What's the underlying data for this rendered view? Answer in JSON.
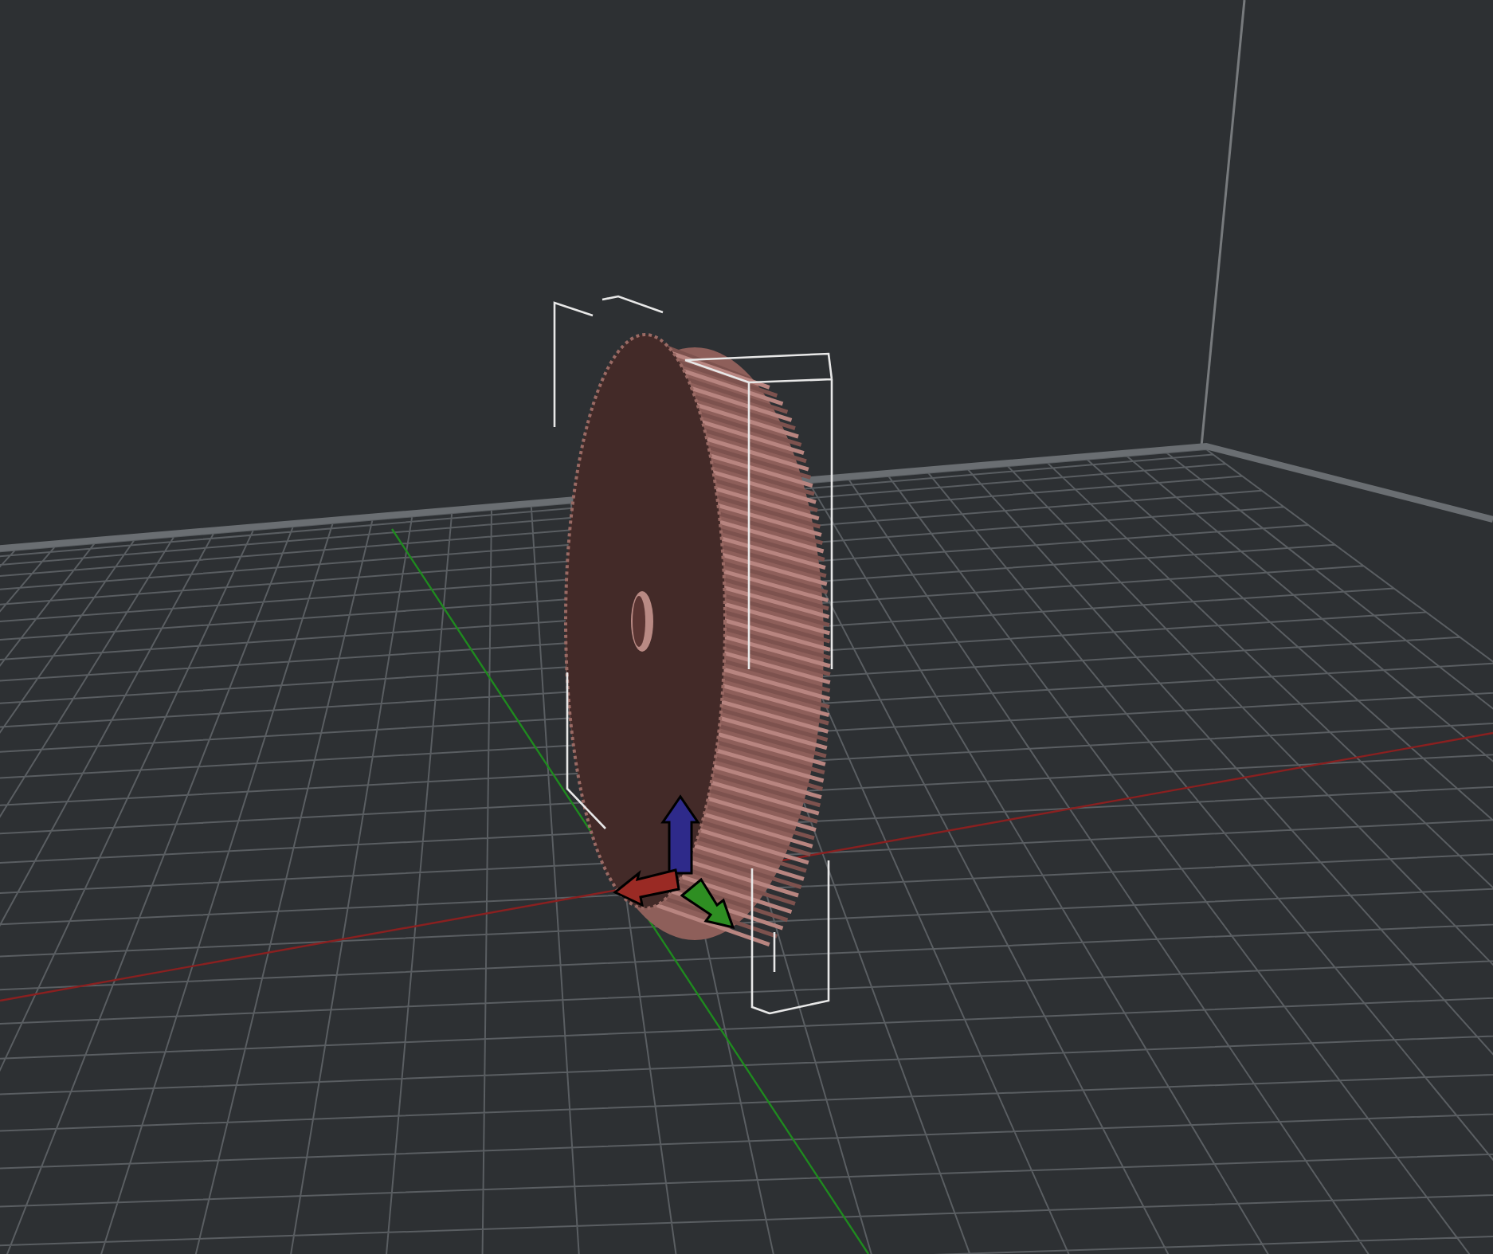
{
  "scene": {
    "objects": [
      {
        "kind": "gear",
        "selected": true
      }
    ]
  }
}
